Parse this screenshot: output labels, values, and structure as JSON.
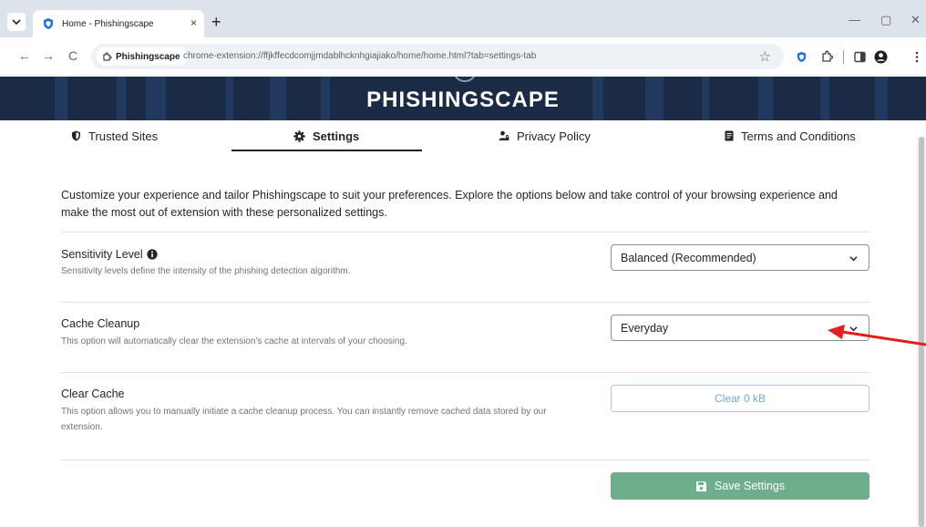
{
  "browser": {
    "tab_title": "Home - Phishingscape",
    "tab_close": "×",
    "new_tab": "+",
    "site_chip": "Phishingscape",
    "url": "chrome-extension://ffjkffecdcomjjmdablhcknhgiajiako/home/home.html?tab=settings-tab",
    "back": "←",
    "forward": "→",
    "reload": "C",
    "star": "☆",
    "minimize": "—",
    "restore": "▢",
    "close": "✕"
  },
  "banner": {
    "title": "PHISHINGSCAPE"
  },
  "nav": {
    "trusted_sites": "Trusted Sites",
    "settings": "Settings",
    "privacy_policy": "Privacy Policy",
    "terms": "Terms and Conditions"
  },
  "settings": {
    "intro": "Customize your experience and tailor Phishingscape to suit your preferences. Explore the options below and take control of your browsing experience and make the most out of extension with these personalized settings.",
    "sensitivity": {
      "title": "Sensitivity Level",
      "description": "Sensitivity levels define the intensity of the phishing detection algorithm.",
      "selected": "Balanced (Recommended)"
    },
    "cache_cleanup": {
      "title": "Cache Cleanup",
      "description": "This option will automatically clear the extension's cache at intervals of your choosing.",
      "selected": "Everyday"
    },
    "clear_cache": {
      "title": "Clear Cache",
      "description": "This option allows you to manually initiate a cache cleanup process. You can instantly remove cached data stored by our extension.",
      "button": "Clear 0 kB"
    },
    "save_button": "Save Settings"
  },
  "colors": {
    "banner_bg": "#1b2b45",
    "save_green": "#6fae8c",
    "clear_blue": "#6ea8e8",
    "annotation_arrow": "#e0201c"
  },
  "icons": {
    "tab_favicon": "shield-icon",
    "trusted_sites": "shield-icon",
    "settings": "gear-icon",
    "privacy_policy": "user-lock-icon",
    "terms": "document-icon",
    "info": "info-icon",
    "save": "floppy-disk-icon",
    "select_chevron": "chevron-down-icon"
  }
}
